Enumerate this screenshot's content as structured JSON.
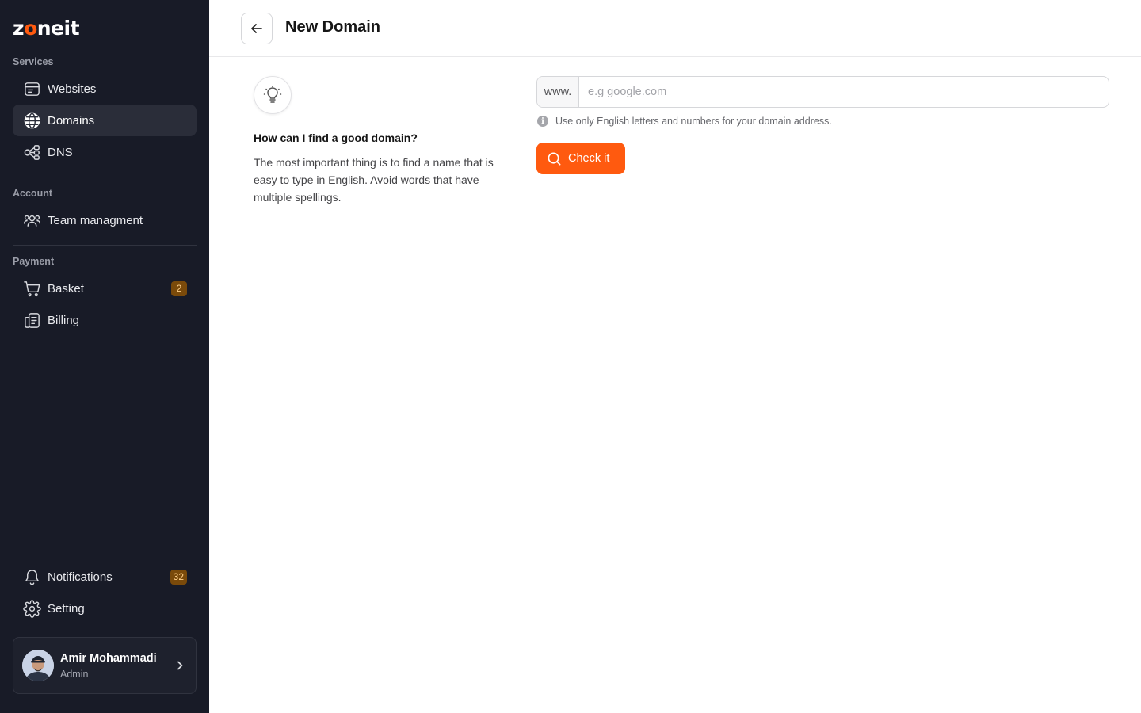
{
  "brand": {
    "prefix": "z",
    "o": "o",
    "suffix": "neit",
    "accent": "#ff5a0f"
  },
  "sidebar": {
    "sections": {
      "services": "Services",
      "account": "Account",
      "payment": "Payment"
    },
    "items": [
      {
        "label": "Websites",
        "icon": "browser-window-icon",
        "active": false
      },
      {
        "label": "Domains",
        "icon": "globe-icon",
        "active": true
      },
      {
        "label": "DNS",
        "icon": "network-nodes-icon",
        "active": false
      },
      {
        "label": "Team managment",
        "icon": "team-users-icon",
        "active": false
      },
      {
        "label": "Basket",
        "icon": "cart-icon",
        "active": false,
        "badge": "2"
      },
      {
        "label": "Billing",
        "icon": "receipt-icon",
        "active": false
      },
      {
        "label": "Notifications",
        "icon": "bell-icon",
        "active": false,
        "badge": "32"
      },
      {
        "label": "Setting",
        "icon": "gear-icon",
        "active": false
      }
    ],
    "user": {
      "name": "Amir Mohammadi",
      "role": "Admin"
    }
  },
  "header": {
    "title": "New Domain"
  },
  "tip": {
    "title": "How can I find a good domain?",
    "text": "The most important thing is to find a name that is easy to type in English. Avoid words that have multiple spellings."
  },
  "domain_form": {
    "prefix": "www.",
    "placeholder": "e.g google.com",
    "value": "",
    "hint": "Use only English letters and numbers for your domain address.",
    "button_label": "Check it"
  },
  "colors": {
    "sidebar_bg": "#181b27",
    "active_item_bg": "#2a2d39",
    "badge_bg": "#7a4a0a",
    "primary_button": "#ff5a0f"
  }
}
